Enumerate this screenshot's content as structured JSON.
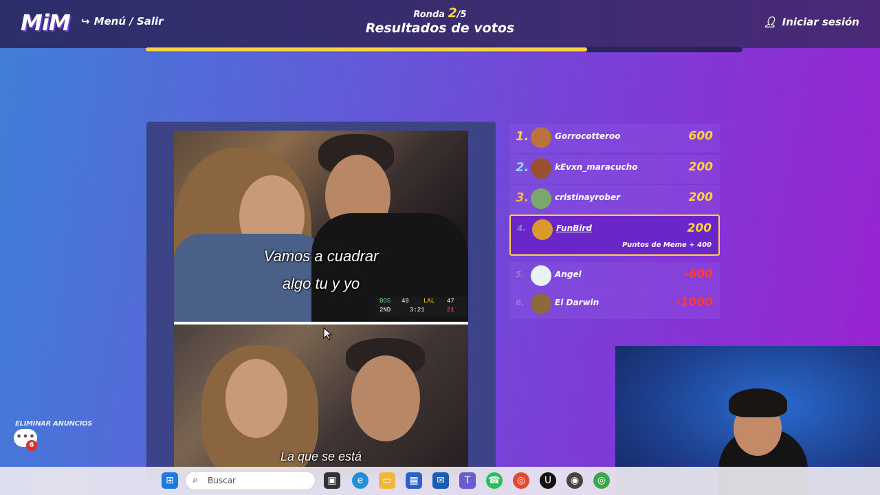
{
  "header": {
    "logo": "MiM",
    "menu_label": "Menú / Salir",
    "round_prefix": "Ronda",
    "round_current": "2",
    "round_total": "/5",
    "title": "Resultados de votos",
    "login_label": "Iniciar sesión",
    "progress_fraction": 0.74
  },
  "meme": {
    "caption_top_line1": "Vamos a cuadrar",
    "caption_top_line2": "algo tu y yo",
    "caption_bottom": "La que se está",
    "scoreboard": {
      "team1": "BOS",
      "score1": "49",
      "team2": "LAL",
      "score2": "47",
      "period": "2ND",
      "clock": "3:21",
      "shot": "21"
    }
  },
  "ranking": [
    {
      "rank": "1.",
      "name": "Gorrocotteroo",
      "score": "600",
      "negative": false,
      "rank_color": "#ffd23f",
      "avatar_color": "#b8743a"
    },
    {
      "rank": "2.",
      "name": "kEvxn_maracucho",
      "score": "200",
      "negative": false,
      "rank_color": "#8fd9ff",
      "avatar_color": "#9a4f2f"
    },
    {
      "rank": "3.",
      "name": "cristinayrober",
      "score": "200",
      "negative": false,
      "rank_color": "#ffb24a",
      "avatar_color": "#7aa86a"
    },
    {
      "rank": "4.",
      "name": "FunBird",
      "score": "200",
      "negative": false,
      "rank_color": "#8c7fd6",
      "avatar_color": "#d99a2a",
      "bonus": "Puntos de Meme + 400"
    },
    {
      "rank": "5.",
      "name": "Angel",
      "score": "-600",
      "negative": true,
      "rank_color": "#8c7fd6",
      "avatar_color": "#e8f2f0"
    },
    {
      "rank": "6.",
      "name": "El Darwin",
      "score": "-1000",
      "negative": true,
      "rank_color": "#8c7fd6",
      "avatar_color": "#8a6a3a"
    }
  ],
  "ads": {
    "label": "ELIMINAR ANUNCIOS",
    "chat_count": "6"
  },
  "taskbar": {
    "search_placeholder": "Buscar"
  }
}
